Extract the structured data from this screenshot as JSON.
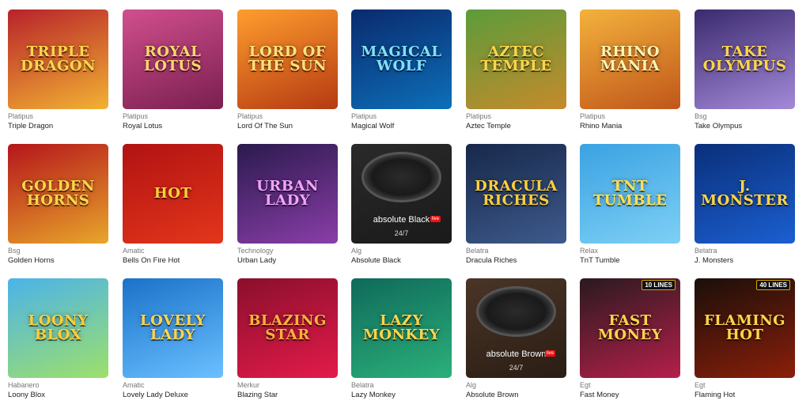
{
  "games": [
    {
      "provider": "Platipus",
      "name": "Triple Dragon",
      "art_text": "TRIPLE DRAGON",
      "bg": [
        "#b8222a",
        "#f2b233"
      ],
      "text_color": "#ffd54a"
    },
    {
      "provider": "Platipus",
      "name": "Royal Lotus",
      "art_text": "ROYAL LOTUS",
      "bg": [
        "#d14f8e",
        "#7a1f4f"
      ],
      "text_color": "#ffd86b"
    },
    {
      "provider": "Platipus",
      "name": "Lord Of The Sun",
      "art_text": "LORD OF THE SUN",
      "bg": [
        "#ff9d2e",
        "#b53a12"
      ],
      "text_color": "#ffe27a"
    },
    {
      "provider": "Platipus",
      "name": "Magical Wolf",
      "art_text": "MAGICAL WOLF",
      "bg": [
        "#0a2a6e",
        "#0d6fb8"
      ],
      "text_color": "#7fe1ff"
    },
    {
      "provider": "Platipus",
      "name": "Aztec Temple",
      "art_text": "AZTEC TEMPLE",
      "bg": [
        "#5c9c3a",
        "#c58a2c"
      ],
      "text_color": "#ffd54a"
    },
    {
      "provider": "Platipus",
      "name": "Rhino Mania",
      "art_text": "RHINO MANIA",
      "bg": [
        "#f3b23c",
        "#c0561a"
      ],
      "text_color": "#fff3b0"
    },
    {
      "provider": "Bsg",
      "name": "Take Olympus",
      "art_text": "TAKE OLYMPUS",
      "bg": [
        "#3b2a6e",
        "#a38ad9"
      ],
      "text_color": "#ffd54a"
    },
    {
      "provider": "Bsg",
      "name": "Golden Horns",
      "art_text": "GOLDEN HORNS",
      "bg": [
        "#b5151b",
        "#e8a62b"
      ],
      "text_color": "#ffd54a"
    },
    {
      "provider": "Amatic",
      "name": "Bells On Fire Hot",
      "art_text": "HOT",
      "bg": [
        "#b11212",
        "#e3361b"
      ],
      "text_color": "#ffcf3a"
    },
    {
      "provider": "Technology",
      "name": "Urban Lady",
      "art_text": "URBAN LADY",
      "bg": [
        "#2b1a4e",
        "#8a3ea8"
      ],
      "text_color": "#f2a3ff"
    },
    {
      "provider": "Alg",
      "name": "Absolute Black",
      "art_text": "",
      "roulette_label": "absolute Black",
      "roulette_sub": "24/7",
      "live_badge": "live",
      "bg": [
        "#2a2a2a",
        "#1a1a1a"
      ],
      "text_color": "#ffffff"
    },
    {
      "provider": "Belatra",
      "name": "Dracula Riches",
      "art_text": "DRACULA RICHES",
      "bg": [
        "#17284a",
        "#3e5a8c"
      ],
      "text_color": "#ffcf3a"
    },
    {
      "provider": "Relax",
      "name": "TnT Tumble",
      "art_text": "TNT TUMBLE",
      "bg": [
        "#3aa2e2",
        "#7ed0f5"
      ],
      "text_color": "#ffe04d"
    },
    {
      "provider": "Belatra",
      "name": "J. Monsters",
      "art_text": "J. MONSTER",
      "bg": [
        "#0a2f7a",
        "#1b5fd0"
      ],
      "text_color": "#ffd54a"
    },
    {
      "provider": "Habanero",
      "name": "Loony Blox",
      "art_text": "LOONY BLOX",
      "bg": [
        "#4bb3ea",
        "#9ee06a"
      ],
      "text_color": "#ffcf3a"
    },
    {
      "provider": "Amatic",
      "name": "Lovely Lady Deluxe",
      "art_text": "Lovely Lady",
      "bg": [
        "#1a72c9",
        "#6bc0ff"
      ],
      "text_color": "#ffd54a"
    },
    {
      "provider": "Merkur",
      "name": "Blazing Star",
      "art_text": "BLAZING STAR",
      "bg": [
        "#8a0f2c",
        "#e31b4a"
      ],
      "text_color": "#ffb23a"
    },
    {
      "provider": "Belatra",
      "name": "Lazy Monkey",
      "art_text": "LAZY MONKEY",
      "bg": [
        "#0f6a5a",
        "#2bb07a"
      ],
      "text_color": "#ffd54a"
    },
    {
      "provider": "Alg",
      "name": "Absolute Brown",
      "art_text": "",
      "roulette_label": "absolute Brown",
      "roulette_sub": "24/7",
      "live_badge": "live",
      "bg": [
        "#4a3526",
        "#2a1d14"
      ],
      "text_color": "#ffffff"
    },
    {
      "provider": "Egt",
      "name": "Fast Money",
      "art_text": "FAST MONEY",
      "bg": [
        "#2a1a1f",
        "#b51f4a"
      ],
      "text_color": "#ffd54a",
      "lines_badge": "10 LINES"
    },
    {
      "provider": "Egt",
      "name": "Flaming Hot",
      "art_text": "FLAMING HOT",
      "bg": [
        "#1a0f0a",
        "#8a1f0a"
      ],
      "text_color": "#ffd54a",
      "lines_badge": "40 LINES"
    }
  ]
}
